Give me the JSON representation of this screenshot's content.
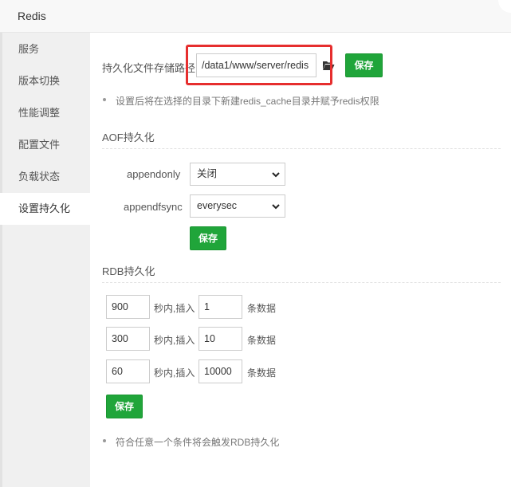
{
  "window": {
    "title": "Redis"
  },
  "sidebar": {
    "items": [
      {
        "label": "服务"
      },
      {
        "label": "版本切换"
      },
      {
        "label": "性能调整"
      },
      {
        "label": "配置文件"
      },
      {
        "label": "负载状态"
      },
      {
        "label": "设置持久化",
        "active": true
      }
    ]
  },
  "storage": {
    "label": "持久化文件存储路径",
    "path_value": "/data1/www/server/redis",
    "save_label": "保存",
    "hint": "设置后将在选择的目录下新建redis_cache目录并赋予redis权限"
  },
  "aof": {
    "title": "AOF持久化",
    "appendonly_label": "appendonly",
    "appendonly_value": "关闭",
    "appendfsync_label": "appendfsync",
    "appendfsync_value": "everysec",
    "save_label": "保存"
  },
  "rdb": {
    "title": "RDB持久化",
    "rows": [
      {
        "seconds": "900",
        "mid_label": "秒内,插入",
        "count": "1",
        "end_label": "条数据"
      },
      {
        "seconds": "300",
        "mid_label": "秒内,插入",
        "count": "10",
        "end_label": "条数据"
      },
      {
        "seconds": "60",
        "mid_label": "秒内,插入",
        "count": "10000",
        "end_label": "条数据"
      }
    ],
    "save_label": "保存",
    "hint": "符合任意一个条件将会触发RDB持久化"
  },
  "colors": {
    "accent": "#20a53a",
    "highlight": "#e62e2e",
    "sidebar_bg": "#f0f0f0"
  },
  "icons": {
    "folder": "folder-open-icon",
    "dropdown": "chevron-down-icon"
  }
}
